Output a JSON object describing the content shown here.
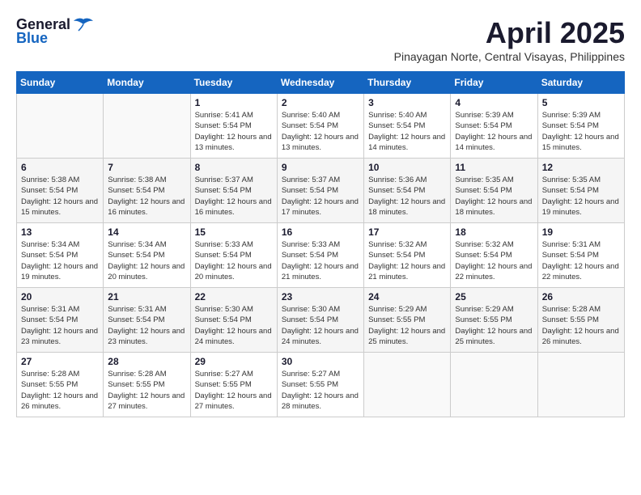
{
  "logo": {
    "general": "General",
    "blue": "Blue"
  },
  "title": {
    "month_year": "April 2025",
    "location": "Pinayagan Norte, Central Visayas, Philippines"
  },
  "headers": [
    "Sunday",
    "Monday",
    "Tuesday",
    "Wednesday",
    "Thursday",
    "Friday",
    "Saturday"
  ],
  "weeks": [
    [
      {
        "day": "",
        "sunrise": "",
        "sunset": "",
        "daylight": ""
      },
      {
        "day": "",
        "sunrise": "",
        "sunset": "",
        "daylight": ""
      },
      {
        "day": "1",
        "sunrise": "Sunrise: 5:41 AM",
        "sunset": "Sunset: 5:54 PM",
        "daylight": "Daylight: 12 hours and 13 minutes."
      },
      {
        "day": "2",
        "sunrise": "Sunrise: 5:40 AM",
        "sunset": "Sunset: 5:54 PM",
        "daylight": "Daylight: 12 hours and 13 minutes."
      },
      {
        "day": "3",
        "sunrise": "Sunrise: 5:40 AM",
        "sunset": "Sunset: 5:54 PM",
        "daylight": "Daylight: 12 hours and 14 minutes."
      },
      {
        "day": "4",
        "sunrise": "Sunrise: 5:39 AM",
        "sunset": "Sunset: 5:54 PM",
        "daylight": "Daylight: 12 hours and 14 minutes."
      },
      {
        "day": "5",
        "sunrise": "Sunrise: 5:39 AM",
        "sunset": "Sunset: 5:54 PM",
        "daylight": "Daylight: 12 hours and 15 minutes."
      }
    ],
    [
      {
        "day": "6",
        "sunrise": "Sunrise: 5:38 AM",
        "sunset": "Sunset: 5:54 PM",
        "daylight": "Daylight: 12 hours and 15 minutes."
      },
      {
        "day": "7",
        "sunrise": "Sunrise: 5:38 AM",
        "sunset": "Sunset: 5:54 PM",
        "daylight": "Daylight: 12 hours and 16 minutes."
      },
      {
        "day": "8",
        "sunrise": "Sunrise: 5:37 AM",
        "sunset": "Sunset: 5:54 PM",
        "daylight": "Daylight: 12 hours and 16 minutes."
      },
      {
        "day": "9",
        "sunrise": "Sunrise: 5:37 AM",
        "sunset": "Sunset: 5:54 PM",
        "daylight": "Daylight: 12 hours and 17 minutes."
      },
      {
        "day": "10",
        "sunrise": "Sunrise: 5:36 AM",
        "sunset": "Sunset: 5:54 PM",
        "daylight": "Daylight: 12 hours and 18 minutes."
      },
      {
        "day": "11",
        "sunrise": "Sunrise: 5:35 AM",
        "sunset": "Sunset: 5:54 PM",
        "daylight": "Daylight: 12 hours and 18 minutes."
      },
      {
        "day": "12",
        "sunrise": "Sunrise: 5:35 AM",
        "sunset": "Sunset: 5:54 PM",
        "daylight": "Daylight: 12 hours and 19 minutes."
      }
    ],
    [
      {
        "day": "13",
        "sunrise": "Sunrise: 5:34 AM",
        "sunset": "Sunset: 5:54 PM",
        "daylight": "Daylight: 12 hours and 19 minutes."
      },
      {
        "day": "14",
        "sunrise": "Sunrise: 5:34 AM",
        "sunset": "Sunset: 5:54 PM",
        "daylight": "Daylight: 12 hours and 20 minutes."
      },
      {
        "day": "15",
        "sunrise": "Sunrise: 5:33 AM",
        "sunset": "Sunset: 5:54 PM",
        "daylight": "Daylight: 12 hours and 20 minutes."
      },
      {
        "day": "16",
        "sunrise": "Sunrise: 5:33 AM",
        "sunset": "Sunset: 5:54 PM",
        "daylight": "Daylight: 12 hours and 21 minutes."
      },
      {
        "day": "17",
        "sunrise": "Sunrise: 5:32 AM",
        "sunset": "Sunset: 5:54 PM",
        "daylight": "Daylight: 12 hours and 21 minutes."
      },
      {
        "day": "18",
        "sunrise": "Sunrise: 5:32 AM",
        "sunset": "Sunset: 5:54 PM",
        "daylight": "Daylight: 12 hours and 22 minutes."
      },
      {
        "day": "19",
        "sunrise": "Sunrise: 5:31 AM",
        "sunset": "Sunset: 5:54 PM",
        "daylight": "Daylight: 12 hours and 22 minutes."
      }
    ],
    [
      {
        "day": "20",
        "sunrise": "Sunrise: 5:31 AM",
        "sunset": "Sunset: 5:54 PM",
        "daylight": "Daylight: 12 hours and 23 minutes."
      },
      {
        "day": "21",
        "sunrise": "Sunrise: 5:31 AM",
        "sunset": "Sunset: 5:54 PM",
        "daylight": "Daylight: 12 hours and 23 minutes."
      },
      {
        "day": "22",
        "sunrise": "Sunrise: 5:30 AM",
        "sunset": "Sunset: 5:54 PM",
        "daylight": "Daylight: 12 hours and 24 minutes."
      },
      {
        "day": "23",
        "sunrise": "Sunrise: 5:30 AM",
        "sunset": "Sunset: 5:54 PM",
        "daylight": "Daylight: 12 hours and 24 minutes."
      },
      {
        "day": "24",
        "sunrise": "Sunrise: 5:29 AM",
        "sunset": "Sunset: 5:55 PM",
        "daylight": "Daylight: 12 hours and 25 minutes."
      },
      {
        "day": "25",
        "sunrise": "Sunrise: 5:29 AM",
        "sunset": "Sunset: 5:55 PM",
        "daylight": "Daylight: 12 hours and 25 minutes."
      },
      {
        "day": "26",
        "sunrise": "Sunrise: 5:28 AM",
        "sunset": "Sunset: 5:55 PM",
        "daylight": "Daylight: 12 hours and 26 minutes."
      }
    ],
    [
      {
        "day": "27",
        "sunrise": "Sunrise: 5:28 AM",
        "sunset": "Sunset: 5:55 PM",
        "daylight": "Daylight: 12 hours and 26 minutes."
      },
      {
        "day": "28",
        "sunrise": "Sunrise: 5:28 AM",
        "sunset": "Sunset: 5:55 PM",
        "daylight": "Daylight: 12 hours and 27 minutes."
      },
      {
        "day": "29",
        "sunrise": "Sunrise: 5:27 AM",
        "sunset": "Sunset: 5:55 PM",
        "daylight": "Daylight: 12 hours and 27 minutes."
      },
      {
        "day": "30",
        "sunrise": "Sunrise: 5:27 AM",
        "sunset": "Sunset: 5:55 PM",
        "daylight": "Daylight: 12 hours and 28 minutes."
      },
      {
        "day": "",
        "sunrise": "",
        "sunset": "",
        "daylight": ""
      },
      {
        "day": "",
        "sunrise": "",
        "sunset": "",
        "daylight": ""
      },
      {
        "day": "",
        "sunrise": "",
        "sunset": "",
        "daylight": ""
      }
    ]
  ]
}
